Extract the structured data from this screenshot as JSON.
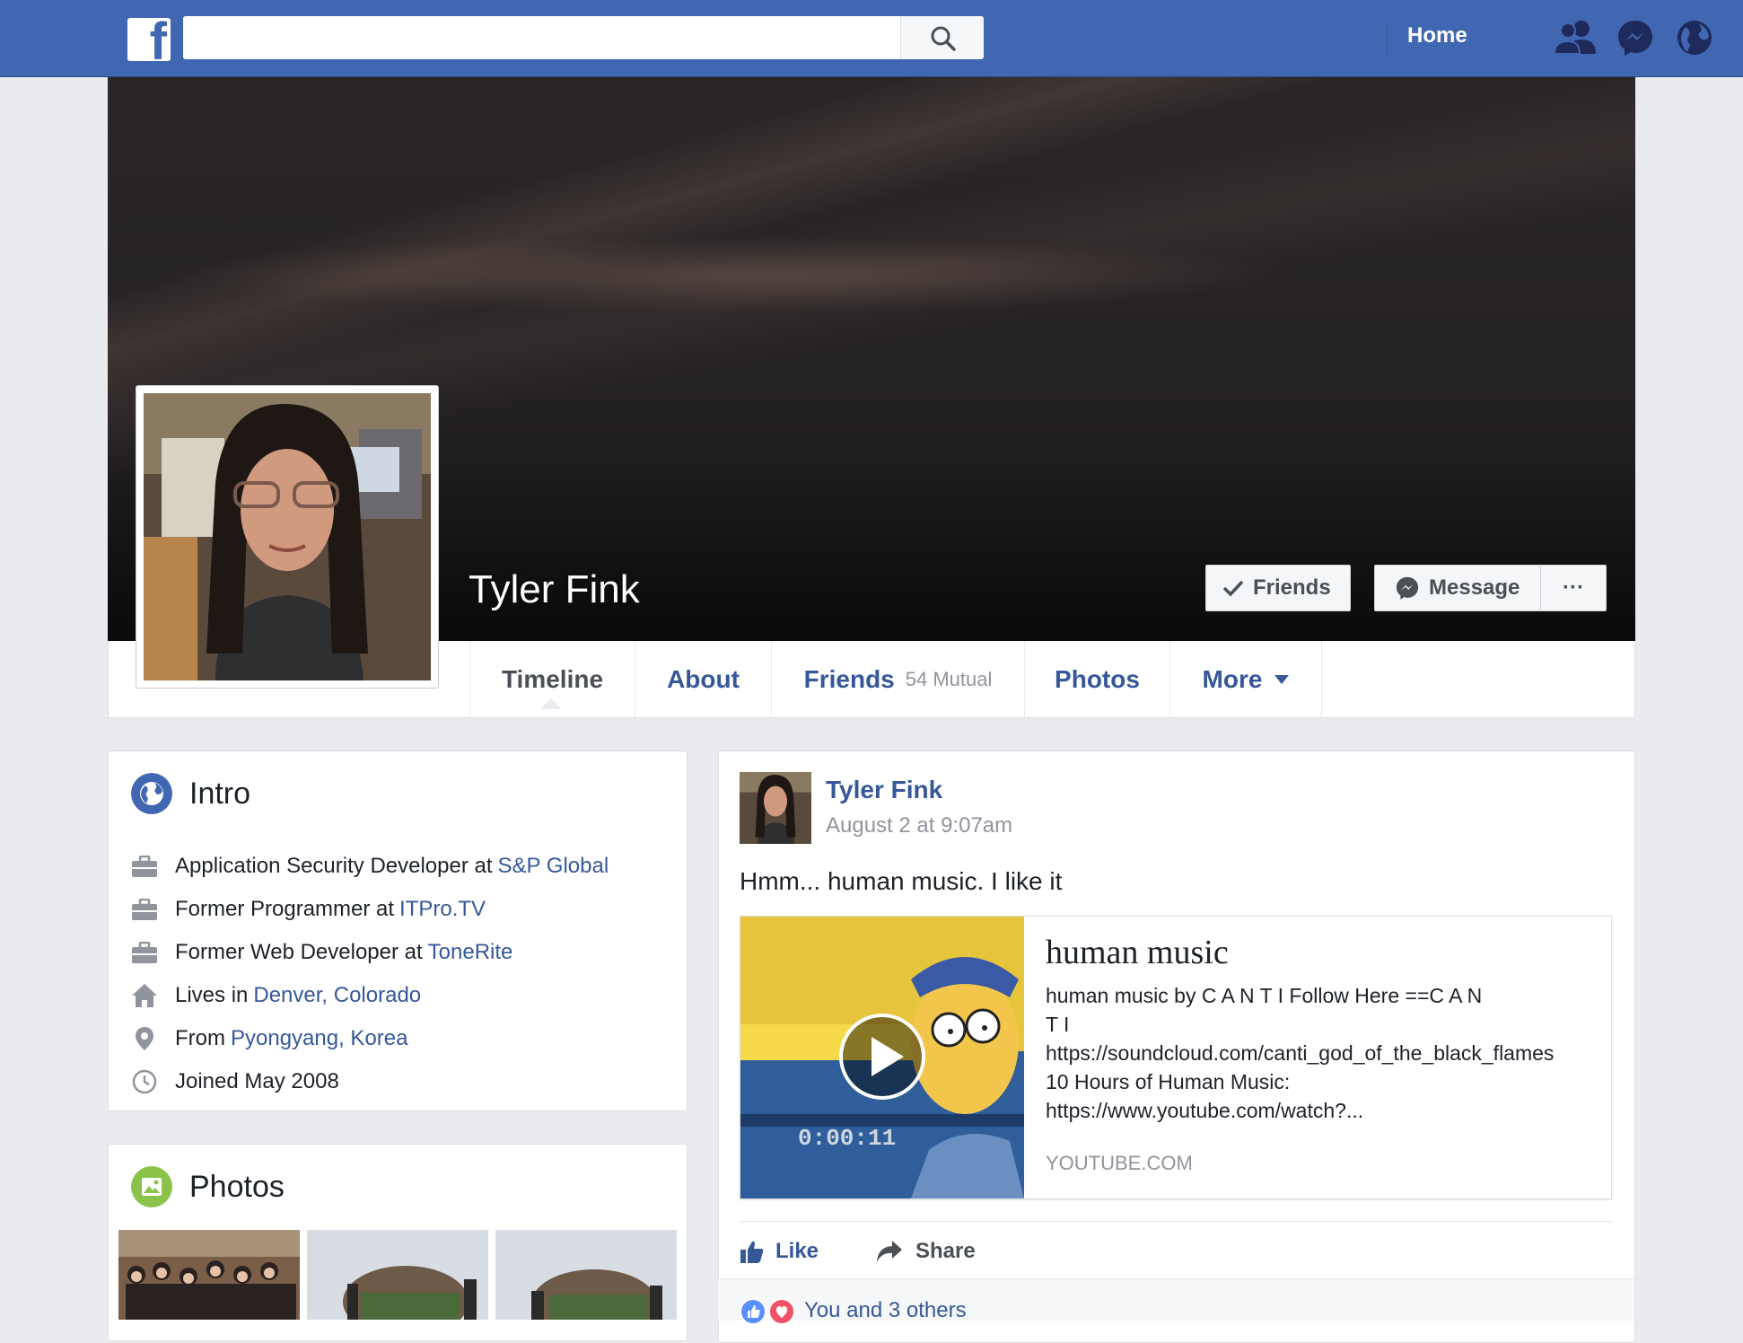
{
  "topbar": {
    "logo": "f",
    "search_placeholder": "",
    "home_label": "Home",
    "icons": [
      "friend-requests-icon",
      "messenger-icon",
      "notifications-globe-icon"
    ],
    "brand_color": "#4267b2"
  },
  "profile": {
    "name": "Tyler Fink",
    "buttons": {
      "friends": "Friends",
      "message": "Message",
      "more": "···"
    }
  },
  "tabs": [
    {
      "label": "Timeline",
      "sub": ""
    },
    {
      "label": "About",
      "sub": ""
    },
    {
      "label": "Friends",
      "sub": "54 Mutual"
    },
    {
      "label": "Photos",
      "sub": ""
    },
    {
      "label": "More",
      "sub": ""
    }
  ],
  "intro": {
    "title": "Intro",
    "rows": [
      {
        "icon": "briefcase-icon",
        "text": "Application Security Developer at",
        "link": "S&P Global"
      },
      {
        "icon": "briefcase-icon",
        "text": "Former Programmer at",
        "link": "ITPro.TV"
      },
      {
        "icon": "briefcase-icon",
        "text": "Former Web Developer at",
        "link": "ToneRite"
      },
      {
        "icon": "home-icon",
        "text": "Lives in",
        "link": "Denver, Colorado"
      },
      {
        "icon": "location-pin-icon",
        "text": "From",
        "link": "Pyongyang, Korea"
      },
      {
        "icon": "clock-icon",
        "text": "Joined May 2008",
        "link": ""
      }
    ]
  },
  "photos": {
    "title": "Photos"
  },
  "post": {
    "author": "Tyler Fink",
    "time": "August 2 at 9:07am",
    "text": "Hmm... human music. I like it",
    "attachment": {
      "title": "human music",
      "desc_lines": [
        "human music by C  A  N  T  I  Follow Here ==C  A  N",
        "T  I",
        "https://soundcloud.com/canti_god_of_the_black_flames",
        "10 Hours of Human Music:",
        "https://www.youtube.com/watch?..."
      ],
      "source": "YOUTUBE.COM",
      "video_timestamp": "0:00:11"
    },
    "actions": {
      "like": "Like",
      "share": "Share"
    },
    "reactions": "You and 3 others"
  }
}
